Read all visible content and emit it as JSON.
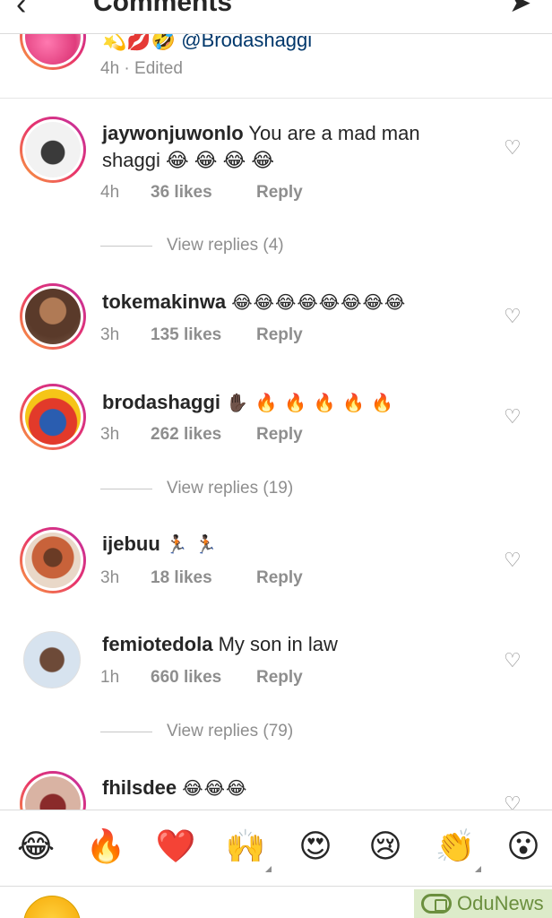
{
  "header": {
    "back_icon": "‹",
    "title": "Comments",
    "send_icon": "➤"
  },
  "previous_comment": {
    "text": "💫💋🤣 @Brodashaggi",
    "meta": "4h · Edited"
  },
  "comments": [
    {
      "username": "jaywonjuwonlo",
      "text": "You are a mad man",
      "text2": "shaggi 😂 😂 😂 😂",
      "time": "4h",
      "likes": "36 likes",
      "reply": "Reply",
      "view_replies": "View replies (4)"
    },
    {
      "username": "tokemakinwa",
      "text": "😂😂😂😂😂😂😂😂",
      "time": "3h",
      "likes": "135 likes",
      "reply": "Reply"
    },
    {
      "username": "brodashaggi",
      "text": "✋🏿 🔥 🔥 🔥 🔥 🔥",
      "time": "3h",
      "likes": "262 likes",
      "reply": "Reply",
      "view_replies": "View replies (19)"
    },
    {
      "username": "ijebuu",
      "text": "🏃🏿 🏃🏿",
      "time": "3h",
      "likes": "18 likes",
      "reply": "Reply"
    },
    {
      "username": "femiotedola",
      "text": "My son in law",
      "time": "1h",
      "likes": "660 likes",
      "reply": "Reply",
      "view_replies": "View replies (79)"
    },
    {
      "username": "fhilsdee",
      "text": "😂😂😂"
    }
  ],
  "heart_icon": "♡",
  "emoji_bar": [
    "😂",
    "🔥",
    "❤️",
    "🙌",
    "😍",
    "😢",
    "👏",
    "😮"
  ],
  "watermark": "OduNews",
  "colors": {
    "ring_start": "#f9a23a",
    "ring_mid": "#e8336b",
    "ring_end": "#c130a3",
    "muted": "#8e8e8e",
    "watermark_green": "#6b8f3e"
  }
}
